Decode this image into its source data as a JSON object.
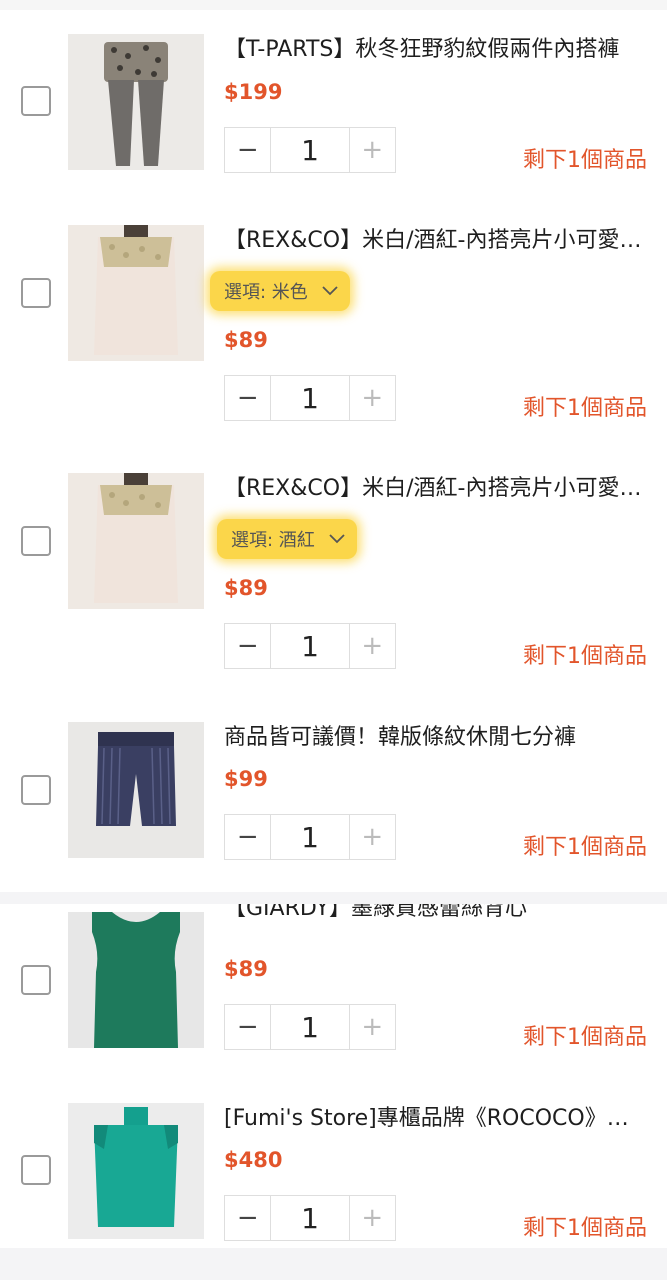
{
  "items": [
    {
      "title": "【T-PARTS】秋冬狂野豹紋假兩件內搭褲",
      "price": "$199",
      "qty": "1",
      "stock": "剩下1個商品",
      "option": null
    },
    {
      "title": "【REX&CO】米白/酒紅-內搭亮片小可愛背心",
      "price": "$89",
      "qty": "1",
      "stock": "剩下1個商品",
      "option": "選項: 米色"
    },
    {
      "title": "【REX&CO】米白/酒紅-內搭亮片小可愛背心",
      "price": "$89",
      "qty": "1",
      "stock": "剩下1個商品",
      "option": "選項: 酒紅"
    },
    {
      "title": "商品皆可議價！韓版條紋休閒七分褲",
      "price": "$99",
      "qty": "1",
      "stock": "剩下1個商品",
      "option": null
    },
    {
      "title": "【GIARDY】墨綠質感蕾絲背心",
      "price": "$89",
      "qty": "1",
      "stock": "剩下1個商品",
      "option": null
    },
    {
      "title": "[Fumi's Store]專櫃品牌《ROCOCO》綠色背心",
      "price": "$480",
      "qty": "1",
      "stock": "剩下1個商品",
      "option": null
    }
  ],
  "stepper": {
    "minus": "−",
    "plus": "+"
  },
  "icons": {
    "option_dropdown": "chevron-down-icon"
  },
  "colors": {
    "price": "#e2552b",
    "highlight": "#fbd64a"
  }
}
